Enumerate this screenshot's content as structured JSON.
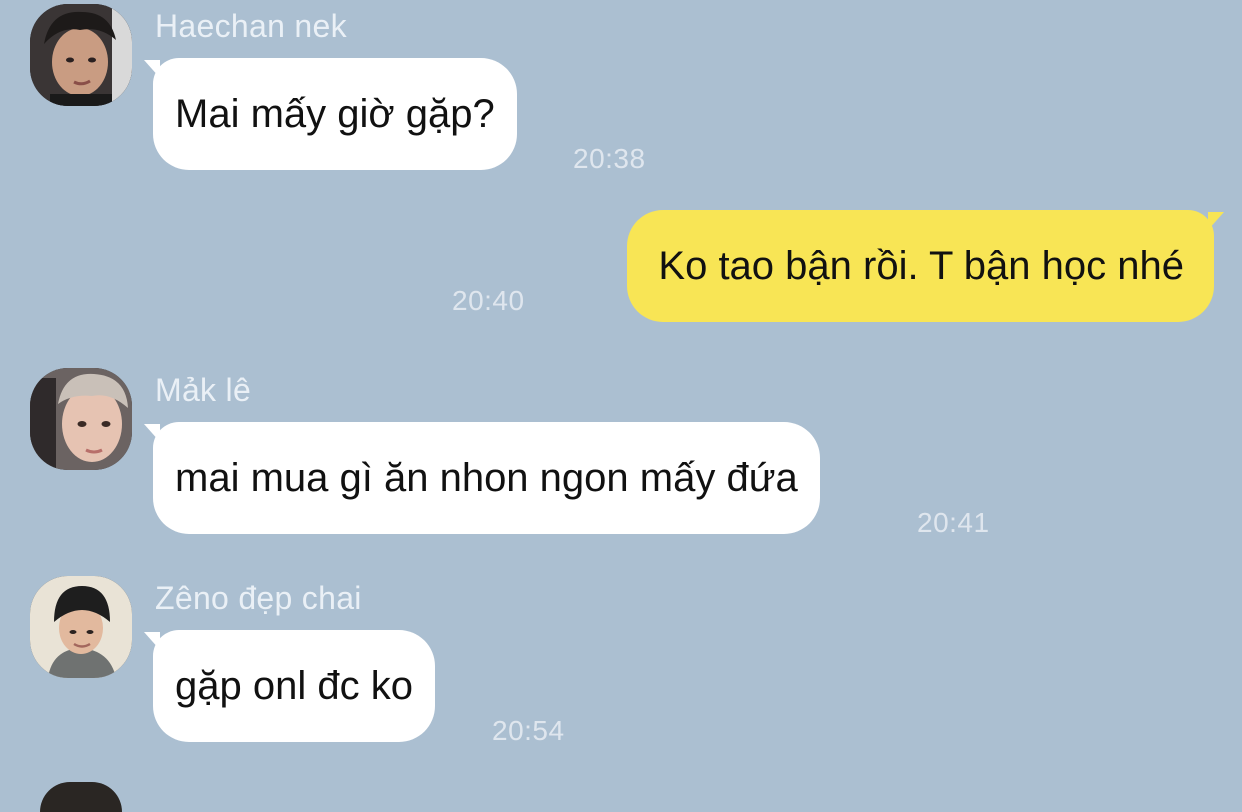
{
  "messages": [
    {
      "sender": "Haechan nek",
      "text": "Mai mấy giờ gặp?",
      "time": "20:38",
      "direction": "incoming",
      "avatar": "haechan-avatar"
    },
    {
      "sender": "",
      "text": "Ko tao bận rồi. T bận học nhé",
      "time": "20:40",
      "direction": "outgoing"
    },
    {
      "sender": "Mảk lê",
      "text": "mai mua gì ăn nhon ngon mấy đứa",
      "time": "20:41",
      "direction": "incoming",
      "avatar": "mark-avatar"
    },
    {
      "sender": "Zêno đẹp chai",
      "text": "gặp onl đc ko",
      "time": "20:54",
      "direction": "incoming",
      "avatar": "zeno-avatar"
    }
  ],
  "colors": {
    "background": "#abbfd1",
    "incoming_bubble": "#ffffff",
    "outgoing_bubble": "#f8e555",
    "name_text": "#eaf0f6",
    "time_text": "#dfe6ee"
  }
}
